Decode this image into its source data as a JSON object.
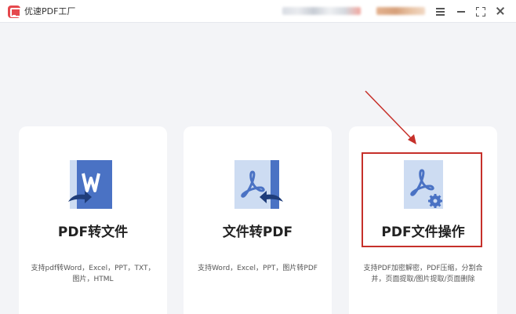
{
  "window": {
    "title": "优速PDF工厂",
    "controls": [
      "menu-icon",
      "minimize-icon",
      "maximize-icon",
      "close-icon"
    ]
  },
  "header": {
    "user_area": "(blurred)",
    "vip_area": "(blurred)"
  },
  "cards": [
    {
      "title": "PDF转文件",
      "description": "支持pdf转Word，Excel，PPT，TXT，图片，HTML",
      "icon": "pdf-to-word-icon"
    },
    {
      "title": "文件转PDF",
      "description": "支持Word，Excel，PPT，图片转PDF",
      "icon": "file-to-pdf-icon"
    },
    {
      "title": "PDF文件操作",
      "description": "支持PDF加密解密，PDF压缩，分割合并，页面提取/图片提取/页面删除",
      "icon": "pdf-settings-icon"
    }
  ],
  "colors": {
    "accent_blue": "#4a72c4",
    "light_blue": "#cddcf2",
    "highlight_red": "#c6302a",
    "background": "#f3f4f7"
  }
}
